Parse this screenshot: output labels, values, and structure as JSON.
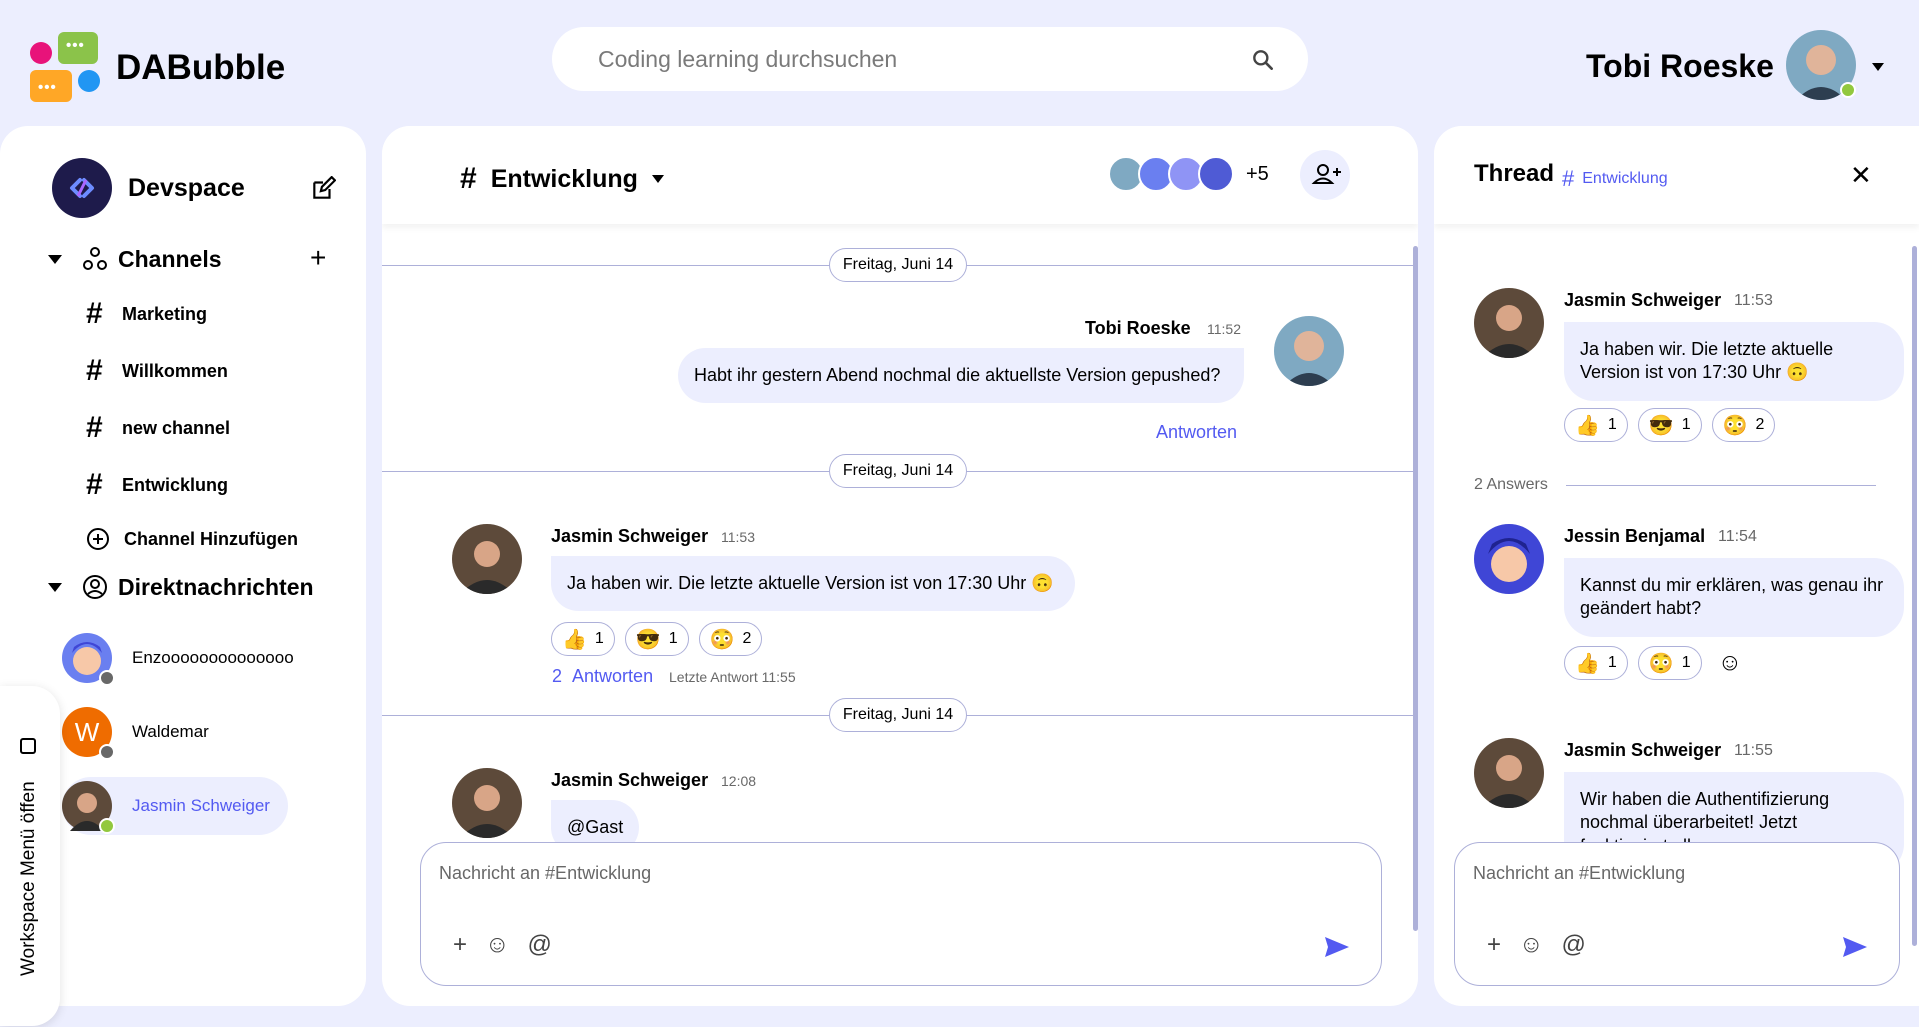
{
  "app": {
    "name": "DABubble",
    "search_placeholder": "Coding learning durchsuchen",
    "user_name": "Tobi Roeske"
  },
  "sidebar": {
    "workspace": "Devspace",
    "channels_label": "Channels",
    "channels": [
      "Marketing",
      "Willkommen",
      "new channel",
      "Entwicklung"
    ],
    "add_channel": "Channel Hinzufügen",
    "dm_label": "Direktnachrichten",
    "dms": [
      {
        "name": "Enzoooooooooooooo",
        "status_color": "#686868"
      },
      {
        "name": "Waldemar",
        "status_color": "#686868",
        "initial": "W"
      },
      {
        "name": "Jasmin Schweiger",
        "status_color": "#92c83e"
      }
    ],
    "ws_toggle": "Workspace Menü öffen"
  },
  "chat": {
    "channel": "Entwicklung",
    "member_count": "+5",
    "messages": [
      {
        "date": "Freitag, Juni 14",
        "name": "Tobi Roeske",
        "time": "11:52",
        "text": "Habt ihr gestern Abend nochmal die aktuellste Version gepushed?",
        "reply_link": "Antworten"
      },
      {
        "date": "Freitag, Juni 14",
        "name": "Jasmin Schweiger",
        "time": "11:53",
        "text": "Ja haben wir. Die letzte aktuelle Version ist von 17:30 Uhr 🙃",
        "reactions": [
          {
            "emoji": "👍",
            "count": "1"
          },
          {
            "emoji": "😎",
            "count": "1"
          },
          {
            "emoji": "😳",
            "count": "2"
          }
        ],
        "answer_count": "2",
        "answer_label": "Antworten",
        "last_reply": "Letzte Antwort 11:55"
      },
      {
        "date": "Freitag, Juni 14",
        "name": "Jasmin Schweiger",
        "time": "12:08",
        "text": "@Gast"
      }
    ],
    "input_placeholder": "Nachricht an #Entwicklung"
  },
  "thread": {
    "title": "Thread",
    "channel": "Entwicklung",
    "messages": [
      {
        "name": "Jasmin Schweiger",
        "time": "11:53",
        "text": "Ja haben wir. Die letzte aktuelle Version ist von 17:30 Uhr 🙃",
        "reactions": [
          {
            "emoji": "👍",
            "count": "1"
          },
          {
            "emoji": "😎",
            "count": "1"
          },
          {
            "emoji": "😳",
            "count": "2"
          }
        ]
      },
      {
        "name": "Jessin Benjamal",
        "time": "11:54",
        "text": "Kannst du mir erklären, was genau ihr geändert habt?",
        "reactions": [
          {
            "emoji": "👍",
            "count": "1"
          },
          {
            "emoji": "😳",
            "count": "1"
          }
        ]
      },
      {
        "name": "Jasmin Schweiger",
        "time": "11:55",
        "text": "Wir haben die Authentifizierung nochmal überarbeitet! Jetzt funktioniert alles"
      }
    ],
    "answers_label": "2  Answers",
    "input_placeholder": "Nachricht an #Entwicklung"
  },
  "colors": {
    "accent": "#535af1",
    "background": "#eceefe",
    "border": "#adb0d9",
    "online": "#92c83e"
  }
}
